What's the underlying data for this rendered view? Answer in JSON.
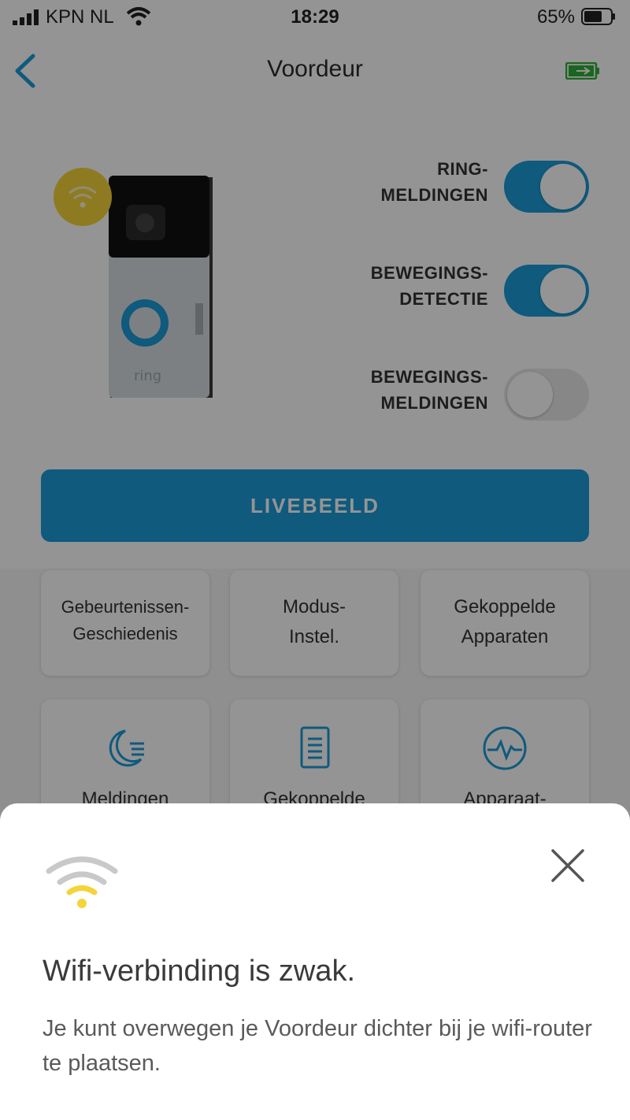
{
  "status_bar": {
    "carrier": "KPN NL",
    "time": "18:29",
    "battery_percent": "65%"
  },
  "nav": {
    "title": "Voordeur"
  },
  "device": {
    "brand_text": "ring"
  },
  "settings": [
    {
      "line1": "RING-",
      "line2": "MELDINGEN",
      "on": true
    },
    {
      "line1": "BEWEGINGS-",
      "line2": "DETECTIE",
      "on": true
    },
    {
      "line1": "BEWEGINGS-",
      "line2": "MELDINGEN",
      "on": false
    }
  ],
  "live_button": "LIVEBEELD",
  "tiles": [
    {
      "label": "Gebeurtenissen-\nGeschiedenis"
    },
    {
      "label": "Modus-\nInstel."
    },
    {
      "label": "Gekoppelde\nApparaten"
    },
    {
      "label": "Meldingen",
      "icon": "moon-icon"
    },
    {
      "label": "Gekoppelde",
      "icon": "document-icon"
    },
    {
      "label": "Apparaat-",
      "icon": "health-icon"
    }
  ],
  "sheet": {
    "title": "Wifi-verbinding is zwak.",
    "body": "Je kunt overwegen je Voordeur dichter bij je wifi-router te plaatsen."
  },
  "colors": {
    "accent": "#1b9cd8",
    "wifi_warning": "#f4d43a",
    "battery_green": "#2fae3a"
  }
}
